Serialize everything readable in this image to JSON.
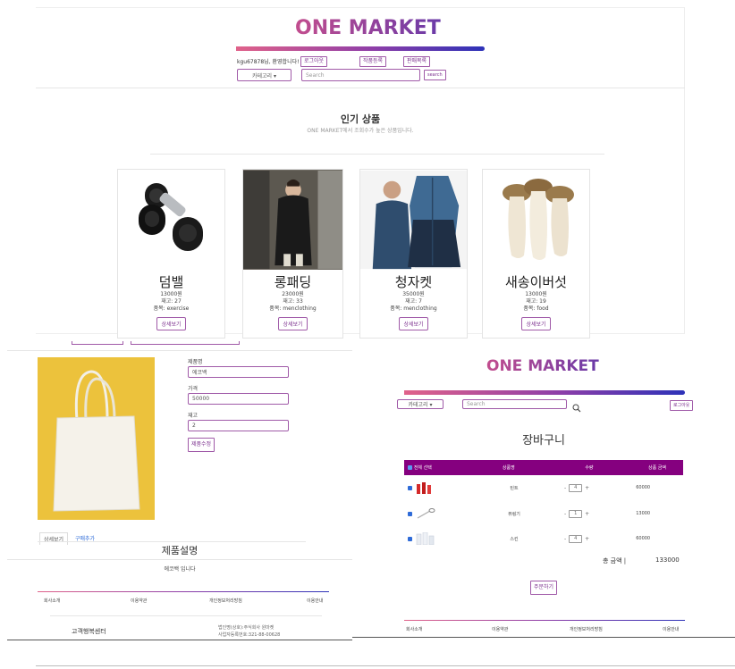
{
  "header": {
    "title": "ONE MARKET",
    "welcome": "kgu67878님, 환영합니다!",
    "logout_label": "로그아웃",
    "add_product_label": "작품등록",
    "order_list_label": "판매목록",
    "category_label": "카테고리 ▾",
    "search_placeholder": "Search",
    "search_button": "search"
  },
  "popular": {
    "title": "인기 상품",
    "subtitle": "ONE MARKET에서 조회수가 높은 상품입니다.",
    "products": [
      {
        "name": "덤밸",
        "price": "13000원",
        "stock": "재고: 27",
        "category": "품목: exercise",
        "detail": "상세보기"
      },
      {
        "name": "롱패딩",
        "price": "23000원",
        "stock": "재고: 33",
        "category": "품목: menclothing",
        "detail": "상세보기"
      },
      {
        "name": "청자켓",
        "price": "35000원",
        "stock": "재고: 7",
        "category": "품목: menclothing",
        "detail": "상세보기"
      },
      {
        "name": "새송이버섯",
        "price": "13000원",
        "stock": "재고: 19",
        "category": "품목: food",
        "detail": "상세보기"
      }
    ]
  },
  "edit": {
    "name_label": "제품명",
    "name_value": "에코백",
    "price_label": "가격",
    "price_value": "50000",
    "stock_label": "재고",
    "stock_value": "2",
    "submit_label": "제품수정",
    "tab_detail": "상세보기",
    "tab_buy": "구매추가",
    "desc_title": "제품설명",
    "desc_text": "에코백 입니다",
    "footer": {
      "about": "회사소개",
      "terms": "이용약관",
      "privacy": "개인정보처리방침",
      "guide": "이용안내",
      "cs": "고객행복센터",
      "company": "법인명(상호):주식회사 원마켓",
      "biz": "사업자등록번호:321-88-00628"
    }
  },
  "cart": {
    "title": "ONE MARKET",
    "category_label": "카테고리 ▾",
    "search_placeholder": "Search",
    "logout_label": "로그아웃",
    "page_title": "장바구니",
    "columns": {
      "select_all": "전체 선택",
      "name": "상품명",
      "qty": "수량",
      "amount": "상품 금액"
    },
    "items": [
      {
        "name": "틴트",
        "qty": "4",
        "amount": "60000"
      },
      {
        "name": "뷰링기",
        "qty": "1",
        "amount": "13000"
      },
      {
        "name": "스킨",
        "qty": "4",
        "amount": "60000"
      }
    ],
    "minus": "-",
    "plus": "+",
    "total_label": "총 금액 |",
    "total_value": "133000",
    "order_label": "주문하기",
    "footer": {
      "about": "회사소개",
      "terms": "이용약관",
      "privacy": "개인정보처리방침",
      "guide": "이용안내"
    }
  }
}
